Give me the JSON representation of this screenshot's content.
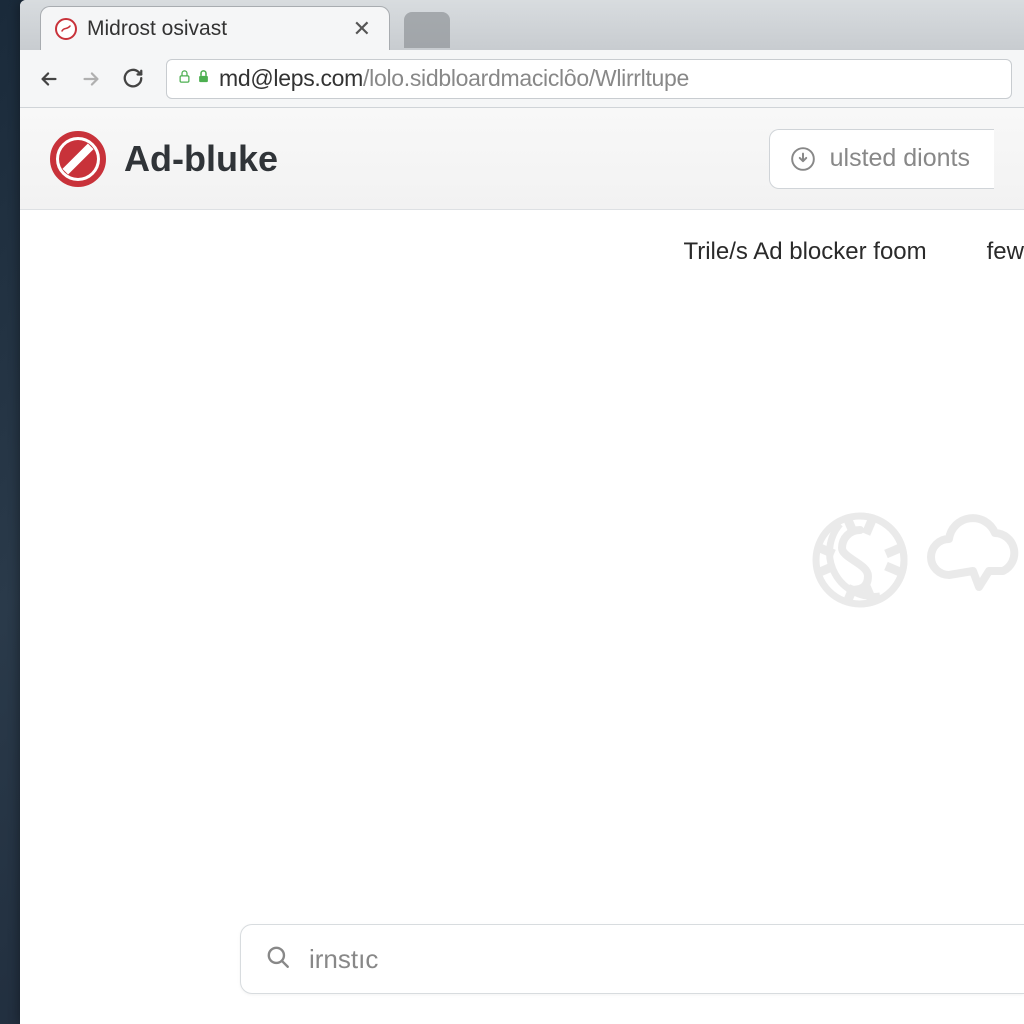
{
  "browser": {
    "tab_title": "Midrost osivast",
    "url_dark": "md@leps.com",
    "url_light": "/lolo.sidbloardmaciclȏo/Wlirrltupe"
  },
  "page": {
    "brand_title": "Ad-bluke",
    "header_button_label": "ulsted dionts",
    "subheader_main": "Trile/s Ad blocker foom",
    "subheader_right": "few",
    "search_value": "irnstıc"
  },
  "colors": {
    "brand_red": "#c8323a",
    "lock_green": "#4caf50"
  }
}
